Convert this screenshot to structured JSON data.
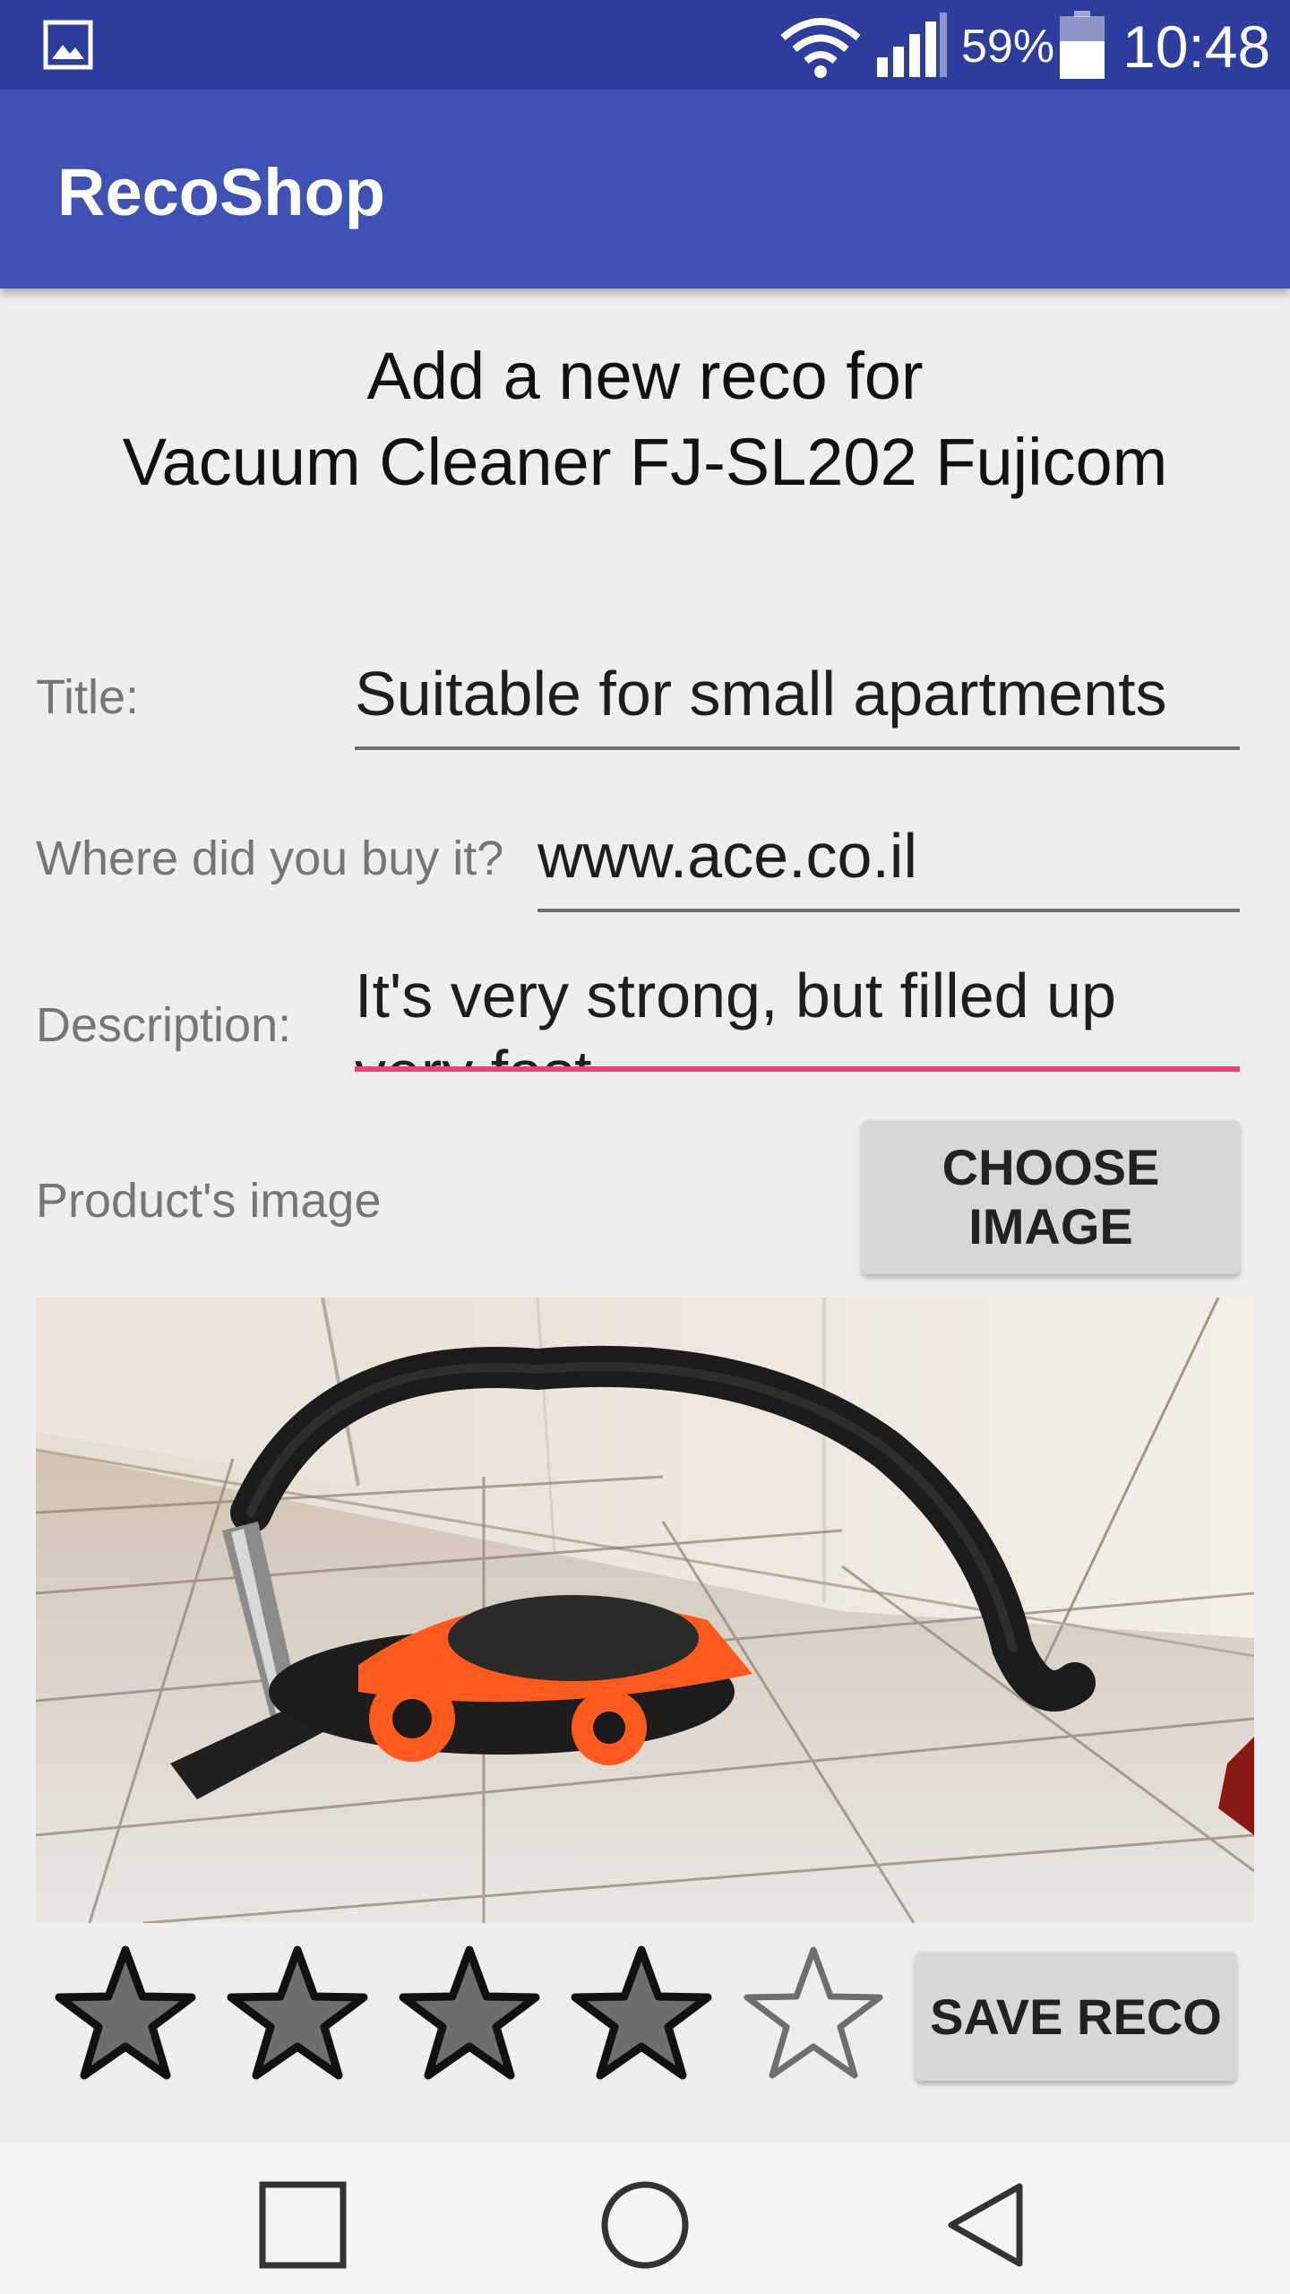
{
  "status_bar": {
    "battery_percent": "59%",
    "time": "10:48",
    "icons": [
      "gallery-icon",
      "wifi-icon",
      "signal-icon",
      "battery-icon"
    ],
    "background": "#2e3d9d"
  },
  "app_bar": {
    "title": "RecoShop",
    "background": "#3f51b5"
  },
  "header": {
    "line1": "Add a new reco for",
    "line2": "Vacuum Cleaner FJ-SL202 Fujicom"
  },
  "form": {
    "title_label": "Title:",
    "title_value": "Suitable for small apartments",
    "where_label": "Where did you buy it?",
    "where_value": "www.ace.co.il",
    "description_label": "Description:",
    "description_value": "It's very strong, but filled up very fast",
    "image_label": "Product's image",
    "choose_image_button": "CHOOSE IMAGE",
    "focus_color": "#e8447f"
  },
  "rating": {
    "value": 4,
    "max": 5
  },
  "save_button": "SAVE RECO",
  "nav_bar": {
    "icons": [
      "recents-square-icon",
      "home-circle-icon",
      "back-triangle-icon"
    ]
  }
}
